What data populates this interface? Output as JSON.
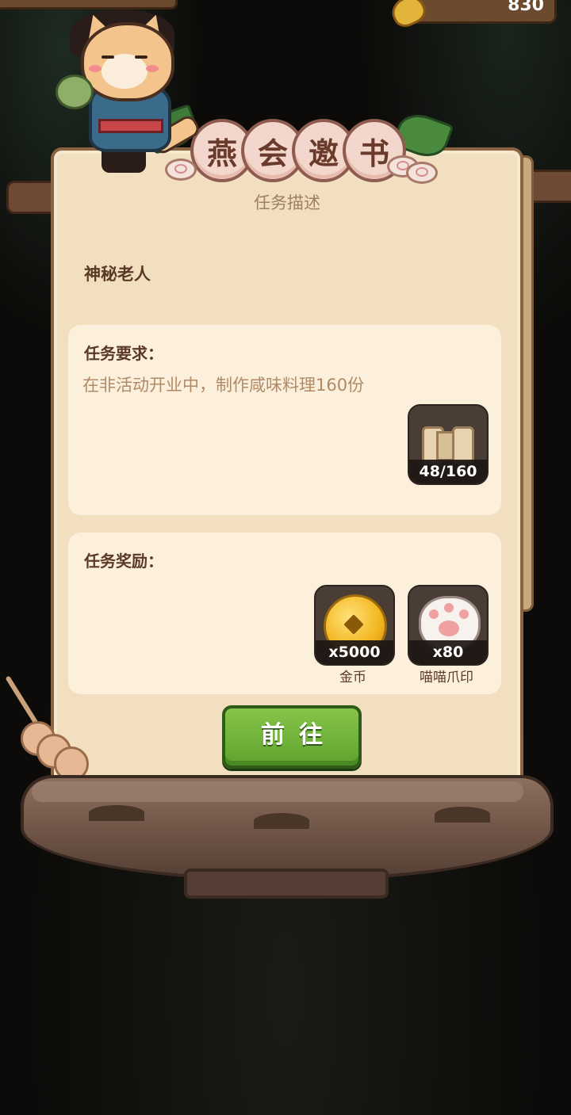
{
  "header": {
    "currency_value": "830"
  },
  "dialog": {
    "title_chars": [
      "燕",
      "会",
      "邀",
      "书"
    ],
    "subtitle": "任务描述",
    "npc_name": "神秘老人",
    "requirement": {
      "heading": "任务要求：",
      "text": "在非活动开业中，制作咸味料理160份",
      "progress_label": "48/160",
      "progress_fraction": 0.3
    },
    "reward": {
      "heading": "任务奖励：",
      "items": [
        {
          "count": "x5000",
          "name": "金币",
          "icon": "gold-coin-icon"
        },
        {
          "count": "x80",
          "name": "喵喵爪印",
          "icon": "paw-print-icon"
        }
      ]
    },
    "go_button_label": "前往"
  },
  "colors": {
    "paper": "#f2dfbf",
    "box": "#fcf0dc",
    "button_green": "#6fb33a",
    "heading_brown": "#5a3a27",
    "muted_text": "#b08a66"
  }
}
